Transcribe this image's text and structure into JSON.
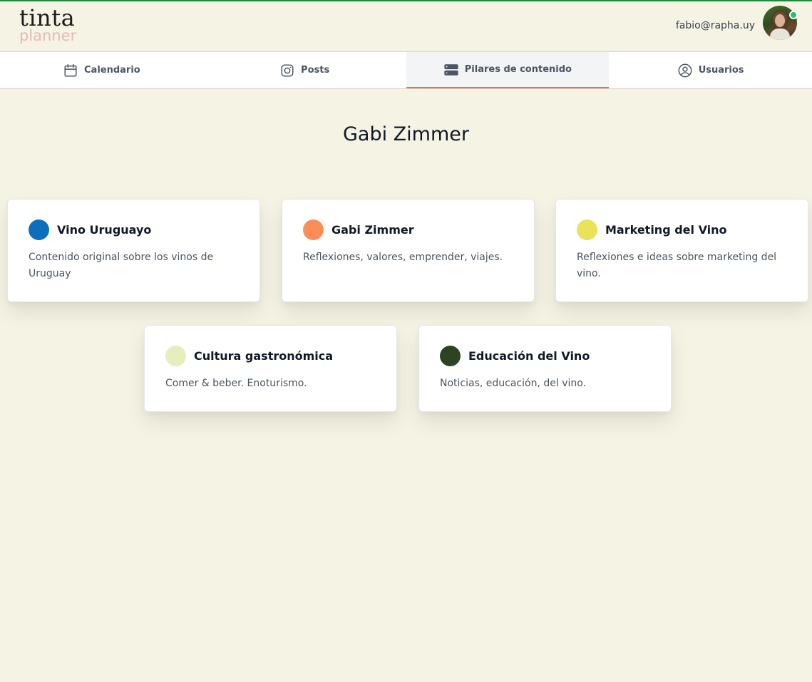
{
  "brand": {
    "name_top": "tinta",
    "name_bottom": "planner"
  },
  "user": {
    "email": "fabio@rapha.uy"
  },
  "nav": {
    "tabs": [
      {
        "label": "Calendario",
        "icon": "calendar-icon"
      },
      {
        "label": "Posts",
        "icon": "instagram-icon"
      },
      {
        "label": "Pilares de contenido",
        "icon": "server-icon",
        "active": true
      },
      {
        "label": "Usuarios",
        "icon": "user-circle-icon"
      }
    ]
  },
  "main": {
    "title": "Gabi Zimmer",
    "pillars": [
      {
        "title": "Vino Uruguayo",
        "description": "Contenido original sobre los vinos de Uruguay",
        "color": "#0b6fbd"
      },
      {
        "title": "Gabi Zimmer",
        "description": "Reflexiones, valores, emprender, viajes.",
        "color": "#fd8d57"
      },
      {
        "title": "Marketing del Vino",
        "description": "Reflexiones e ideas sobre marketing del vino.",
        "color": "#e9e35a"
      },
      {
        "title": "Cultura gastronómica",
        "description": "Comer & beber. Enoturismo.",
        "color": "#e5eebc"
      },
      {
        "title": "Educación del Vino",
        "description": "Noticias, educación, del vino.",
        "color": "#2e4323"
      }
    ]
  },
  "colors": {
    "background": "#f5f3e3",
    "accent_green": "#1f8a3e",
    "active_tab_underline": "#c2873f",
    "online_status": "#22c55e"
  }
}
